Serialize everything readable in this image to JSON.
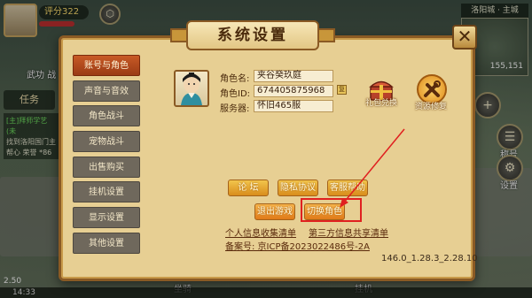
{
  "hud": {
    "score": "评分322",
    "map_name": "洛阳城 · 主城",
    "coord": "155,151",
    "task_tab": "任务",
    "task_line1": "[主]拜师学艺(未",
    "task_line2": "找到洛阳国门主",
    "task_line3": "帮心 荣誉",
    "task_count": "*86",
    "label_wudao": "武功 战",
    "label_chenghao": "称号",
    "label_shezhi": "设置",
    "label_zuoqi": "坐骑",
    "label_guaji": "挂机",
    "time": "14:33",
    "fps": "2.50"
  },
  "dialog": {
    "title": "系统设置",
    "close": "✕"
  },
  "tabs": [
    {
      "label": "账号与角色",
      "active": true
    },
    {
      "label": "声音与音效",
      "active": false
    },
    {
      "label": "角色战斗",
      "active": false
    },
    {
      "label": "宠物战斗",
      "active": false
    },
    {
      "label": "出售购买",
      "active": false
    },
    {
      "label": "挂机设置",
      "active": false
    },
    {
      "label": "显示设置",
      "active": false
    },
    {
      "label": "其他设置",
      "active": false
    }
  ],
  "account": {
    "name_label": "角色名:",
    "name_value": "夹谷癸玖庭",
    "id_label": "角色ID:",
    "id_value": "674405875968",
    "server_label": "服务器:",
    "server_value": "怀旧465服",
    "copy_icon": "复"
  },
  "features": {
    "gift_label": "礼包兑换",
    "repair_label": "资源修复"
  },
  "buttons": {
    "forum": "论 坛",
    "privacy": "隐私协议",
    "service": "客服帮助",
    "logout": "退出游戏",
    "switch_role": "切换角色"
  },
  "links": {
    "personal_info": "个人信息收集清单",
    "third_party": "第三方信息共享清单",
    "icp": "备案号: 京ICP备2023022486号-2A"
  },
  "version": "146.0_1.28.3_2.28.10",
  "colors": {
    "panel_bg": "#e7cf93",
    "panel_border": "#8a5a24",
    "active_tab": "#c85a26",
    "button": "#f2c54c",
    "annotation_red": "#e02020"
  }
}
